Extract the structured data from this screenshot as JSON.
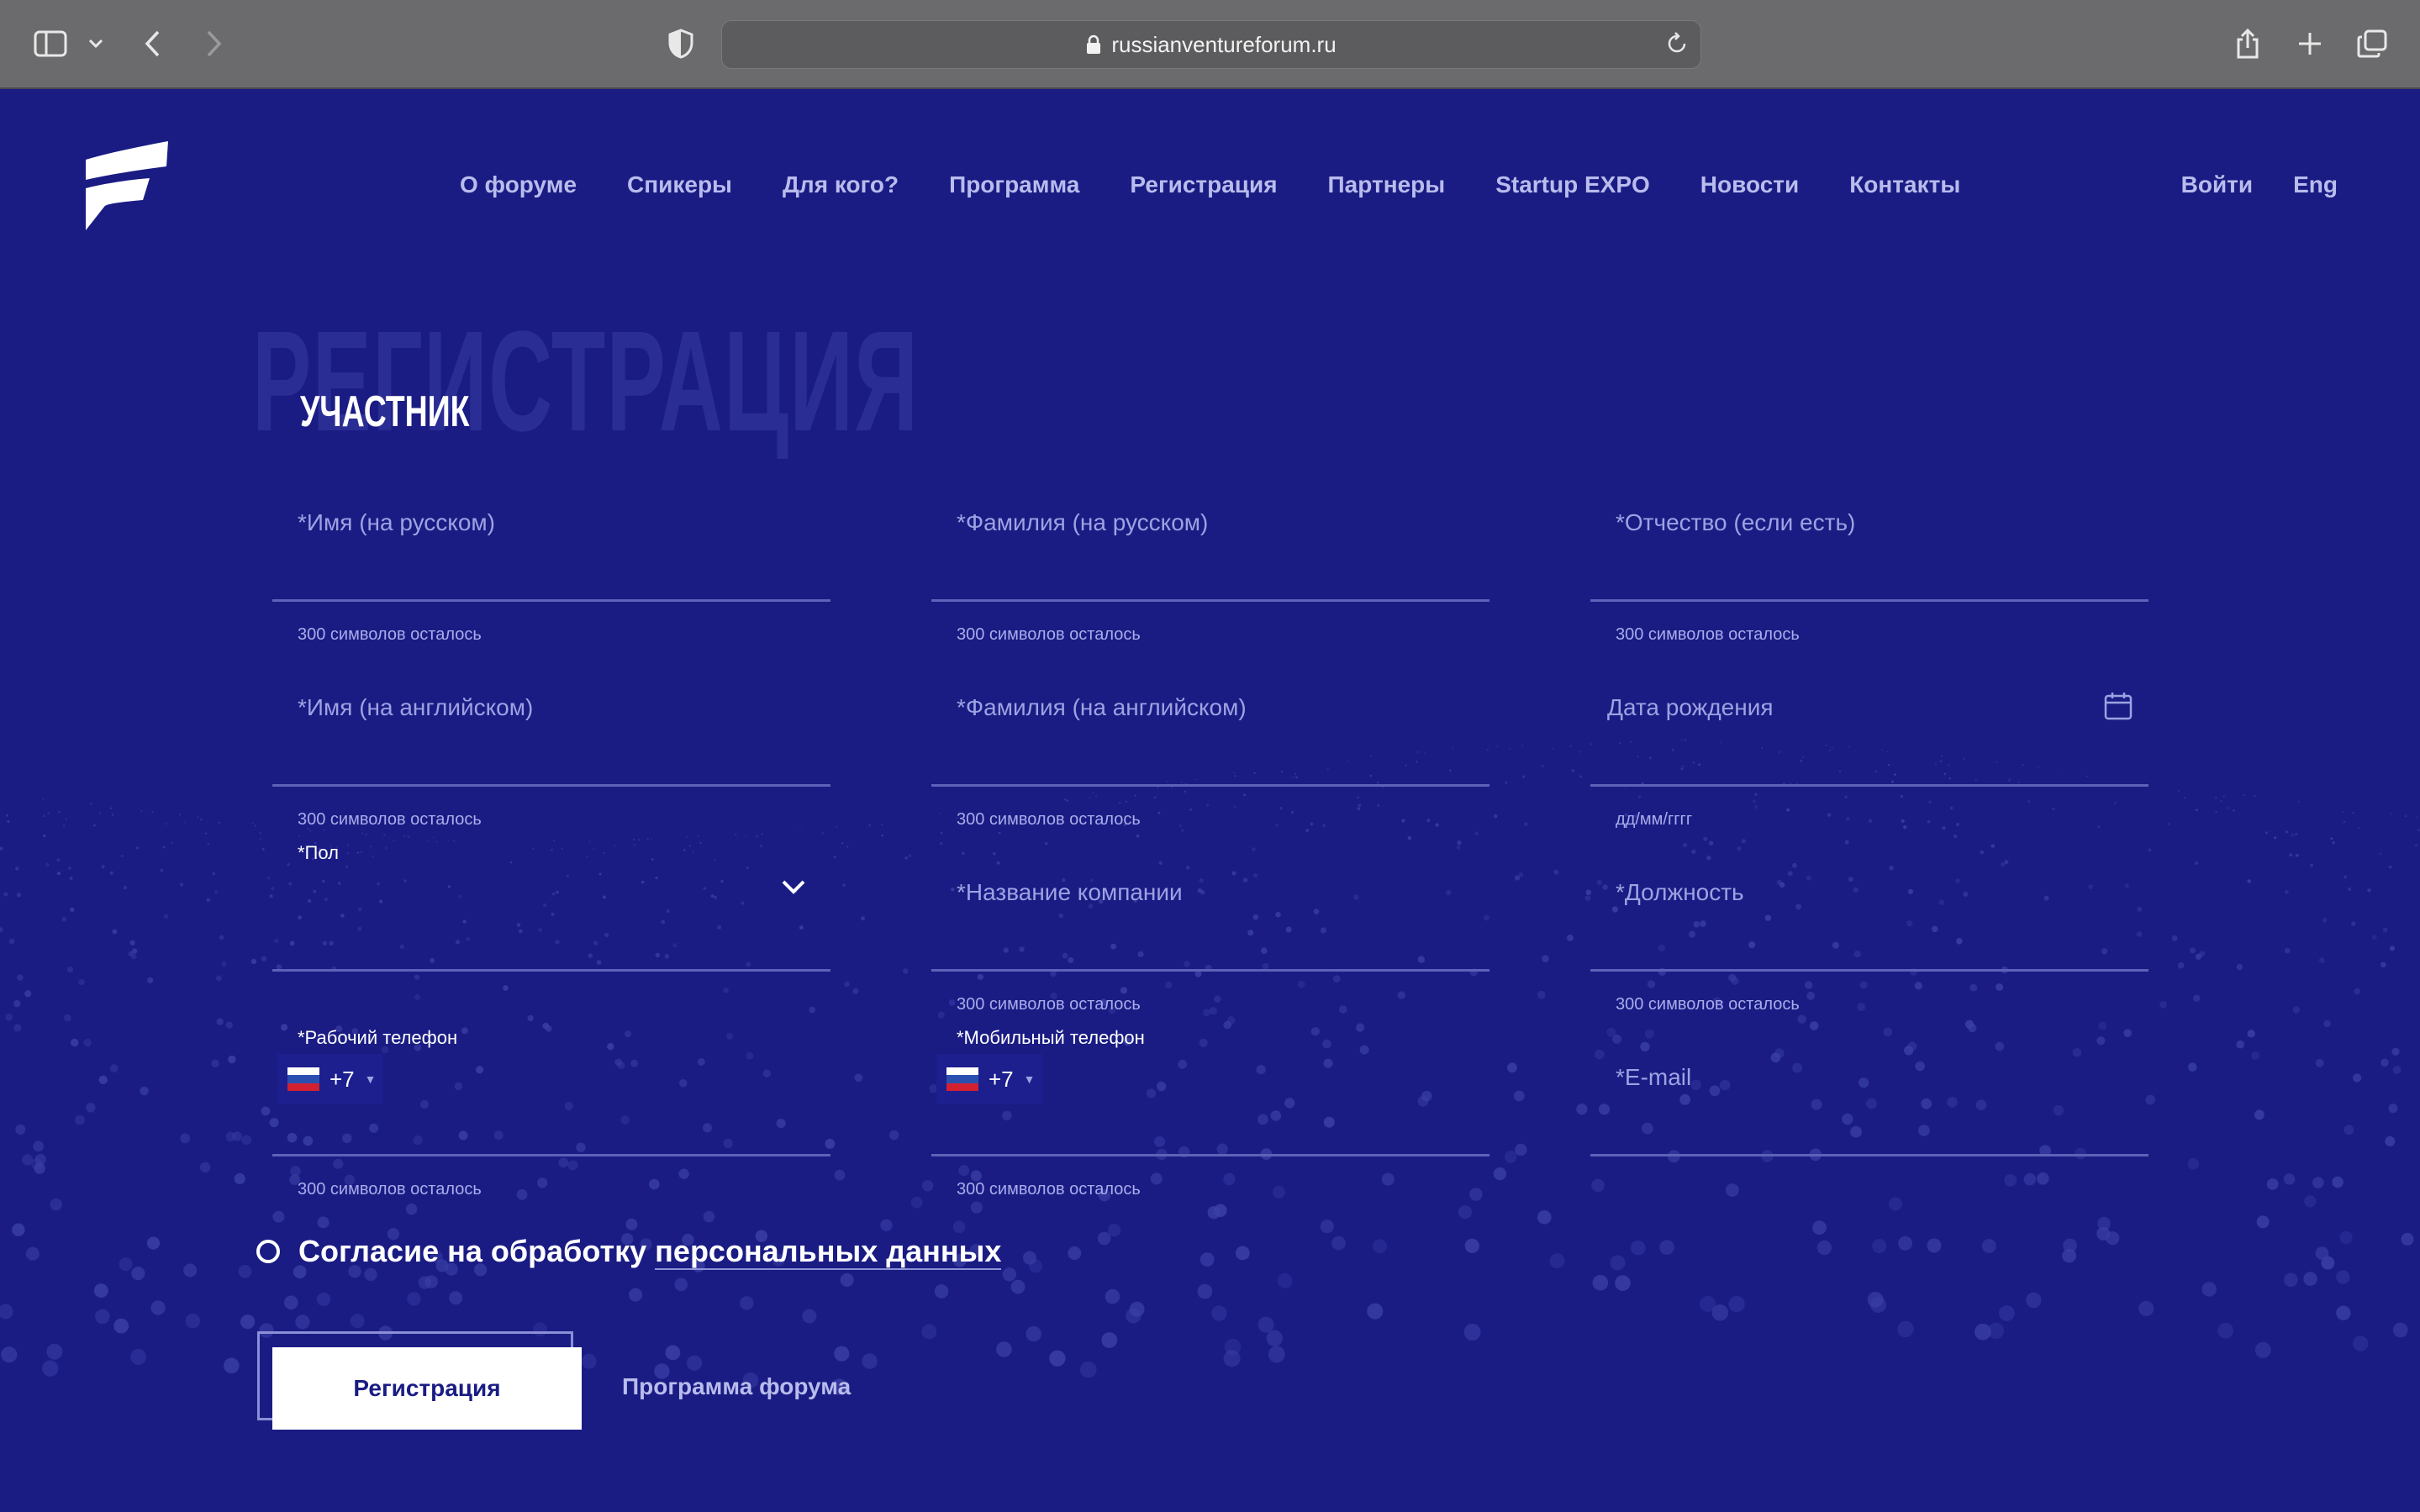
{
  "browser": {
    "url": "russianventureforum.ru"
  },
  "nav": {
    "items": [
      "О форуме",
      "Спикеры",
      "Для кого?",
      "Программа",
      "Регистрация",
      "Партнеры",
      "Startup EXPO",
      "Новости",
      "Контакты"
    ],
    "login": "Войти",
    "lang": "Eng"
  },
  "page": {
    "bigword": "РЕГИСТРАЦИЯ",
    "subtitle": "УЧАСТНИК"
  },
  "form": {
    "first_name_ru": {
      "placeholder": "*Имя (на русском)",
      "hint": "300 символов осталось"
    },
    "last_name_ru": {
      "placeholder": "*Фамилия (на русском)",
      "hint": "300 символов осталось"
    },
    "patronymic": {
      "placeholder": "*Отчество (если есть)",
      "hint": "300 символов осталось"
    },
    "first_name_en": {
      "placeholder": "*Имя (на английском)",
      "hint": "300 символов осталось"
    },
    "last_name_en": {
      "placeholder": "*Фамилия (на английском)",
      "hint": "300 символов осталось"
    },
    "birth_date": {
      "placeholder": "Дата рождения",
      "hint": "дд/мм/гггг"
    },
    "gender": {
      "label": "*Пол"
    },
    "company": {
      "placeholder": "*Название компании",
      "hint": "300 символов осталось"
    },
    "position": {
      "placeholder": "*Должность",
      "hint": "300 символов осталось"
    },
    "work_phone": {
      "label": "*Рабочий телефон",
      "code": "+7",
      "hint": "300 символов осталось"
    },
    "mobile_phone": {
      "label": "*Мобильный телефон",
      "code": "+7",
      "hint": "300 символов осталось"
    },
    "email": {
      "placeholder": "*E-mail"
    },
    "consent_prefix": "Согласие на обработку ",
    "consent_link": "персональных данных",
    "submit": "Регистрация",
    "program_link": "Программа форума"
  },
  "colors": {
    "background": "#1a1c84",
    "accent": "#ffffff",
    "muted": "#9ea2e2"
  }
}
